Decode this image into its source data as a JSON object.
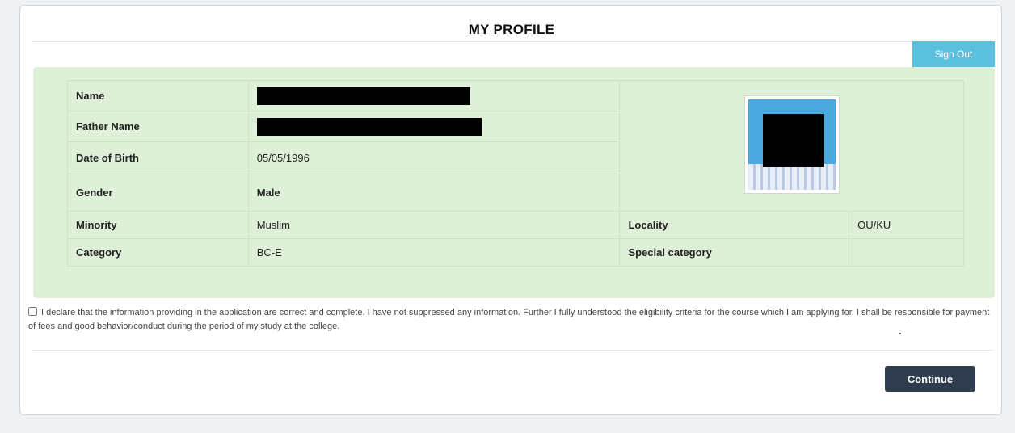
{
  "header": {
    "title": "MY PROFILE",
    "sign_out_label": "Sign Out"
  },
  "profile": {
    "name_label": "Name",
    "father_name_label": "Father Name",
    "dob_label": "Date of Birth",
    "dob_value": "05/05/1996",
    "gender_label": "Gender",
    "gender_value": "Male",
    "minority_label": "Minority",
    "minority_value": "Muslim",
    "locality_label": "Locality",
    "locality_value": "OU/KU",
    "category_label": "Category",
    "category_value": "BC-E",
    "special_category_label": "Special category",
    "special_category_value": ""
  },
  "declaration": {
    "text": "I declare that the information providing in the application are correct and complete. I have not suppressed any information. Further I fully understood the eligibility criteria for the course which I am applying for. I shall be responsible for payment of fees and good behavior/conduct during the period of my study at the college.",
    "checked": false
  },
  "actions": {
    "continue_label": "Continue"
  },
  "colors": {
    "panel_bg": "#dff0d8",
    "sign_out_bg": "#5bc0de",
    "continue_bg": "#2f3d4e"
  }
}
